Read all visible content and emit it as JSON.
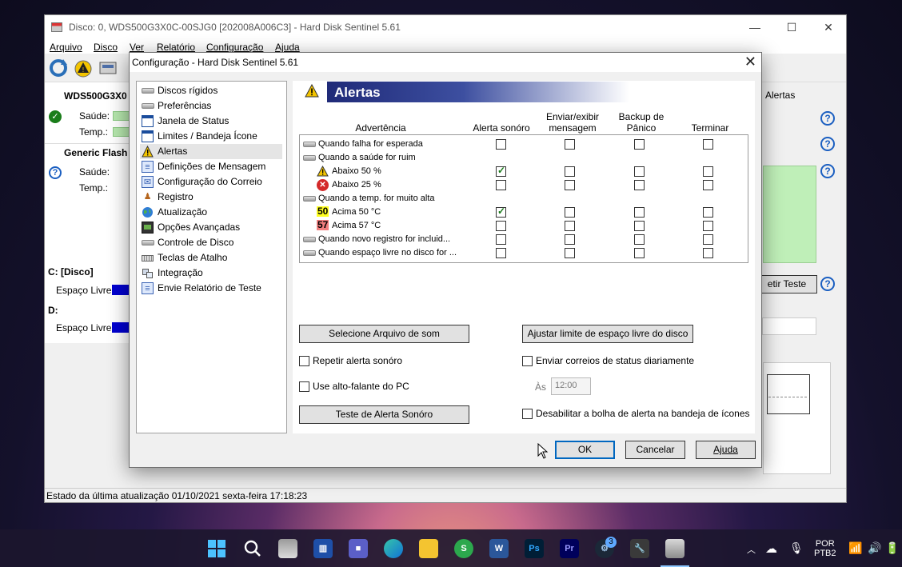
{
  "main_window": {
    "title": "Disco: 0, WDS500G3X0C-00SJG0 [202008A006C3]  -  Hard Disk Sentinel 5.61",
    "menu": [
      "Arquivo",
      "Disco",
      "Ver",
      "Relatório",
      "Configuração",
      "Ajuda"
    ],
    "disk1": {
      "name": "WDS500G3X0",
      "health_label": "Saúde:",
      "temp_label": "Temp.:"
    },
    "disk2": {
      "name": "Generic Flash D",
      "health_label": "Saúde:",
      "temp_label": "Temp.:"
    },
    "volume_c": {
      "name": "C: [Disco]",
      "free_label": "Espaço Livre"
    },
    "volume_d": {
      "name": "D:",
      "free_label": "Espaço Livre"
    },
    "right_tab": "Alertas",
    "right_button": "etir Teste",
    "status_bar": "Estado da última atualização 01/10/2021 sexta-feira 17:18:23"
  },
  "dialog": {
    "title": "Configuração  -  Hard Disk Sentinel 5.61",
    "tree": [
      {
        "label": "Discos rígidos",
        "icon": "hdd-icon"
      },
      {
        "label": "Preferências",
        "icon": "preferences-icon"
      },
      {
        "label": "Janela de Status",
        "icon": "window-icon"
      },
      {
        "label": "Limites / Bandeja Ícone",
        "icon": "limits-icon"
      },
      {
        "label": "Alertas",
        "icon": "warning-icon"
      },
      {
        "label": "Definições de Mensagem",
        "icon": "message-icon"
      },
      {
        "label": "Configuração do Correio",
        "icon": "mail-icon"
      },
      {
        "label": "Registro",
        "icon": "log-icon"
      },
      {
        "label": "Atualização",
        "icon": "globe-icon"
      },
      {
        "label": "Opções Avançadas",
        "icon": "advanced-icon"
      },
      {
        "label": "Controle de Disco",
        "icon": "disk-control-icon"
      },
      {
        "label": "Teclas de Atalho",
        "icon": "keyboard-icon"
      },
      {
        "label": "Integração",
        "icon": "integration-icon"
      },
      {
        "label": "Envie Relatório de Teste",
        "icon": "report-icon"
      }
    ],
    "panel_title": "Alertas",
    "columns": {
      "warning": "Advertência",
      "sound": "Alerta sonóro",
      "msg_line1": "Enviar/exibir",
      "msg_line2": "mensagem",
      "backup_line1": "Backup de",
      "backup_line2": "Pânico",
      "terminate": "Terminar"
    },
    "rows": [
      {
        "label": "Quando falha for esperada",
        "badge": "",
        "checks": [
          false,
          false,
          false,
          false
        ]
      },
      {
        "label": "Quando a saúde for ruim",
        "badge": "",
        "checks": null
      },
      {
        "label": "Abaixo 50 %",
        "badge": "",
        "checks": [
          true,
          false,
          false,
          false
        ]
      },
      {
        "label": "Abaixo 25 %",
        "badge": "",
        "checks": [
          false,
          false,
          false,
          false
        ]
      },
      {
        "label": "Quando a temp. for muito alta",
        "badge": "",
        "checks": null
      },
      {
        "label": "Acima 50 °C",
        "badge": "50",
        "checks": [
          true,
          false,
          false,
          false
        ]
      },
      {
        "label": "Acima 57 °C",
        "badge": "57",
        "checks": [
          false,
          false,
          false,
          false
        ]
      },
      {
        "label": "Quando novo registro for incluid...",
        "badge": "",
        "checks": [
          false,
          false,
          false,
          false
        ]
      },
      {
        "label": "Quando espaço livre no disco for ...",
        "badge": "",
        "checks": [
          false,
          false,
          false,
          false
        ]
      }
    ],
    "buttons": {
      "select_sound": "Selecione Arquivo de som",
      "adjust_space": "Ajustar limite de espaço  livre do disco",
      "test_sound": "Teste de Alerta Sonóro",
      "ok": "OK",
      "cancel": "Cancelar",
      "help": "Ajuda"
    },
    "options": {
      "repeat_sound": {
        "label": "Repetir alerta sonóro",
        "checked": false
      },
      "pc_speaker": {
        "label": "Use alto-falante do PC",
        "checked": false
      },
      "daily_mail": {
        "label": "Enviar correios de status diariamente",
        "checked": false
      },
      "disable_balloon": {
        "label": "Desabilitar a bolha de alerta na bandeja de ícones",
        "checked": false
      }
    },
    "time_label": "Às",
    "time_value": "12:00"
  },
  "taskbar": {
    "steam_badge": "3",
    "language_line1": "POR",
    "language_line2": "PTB2"
  },
  "colors": {
    "accent": "#0067c0",
    "panel_header_dark": "#1f2a78",
    "health_green": "#b6e7ad",
    "volume_blue": "#0000d0",
    "temp_50": "#ffff20",
    "temp_57": "#f27f7f"
  }
}
